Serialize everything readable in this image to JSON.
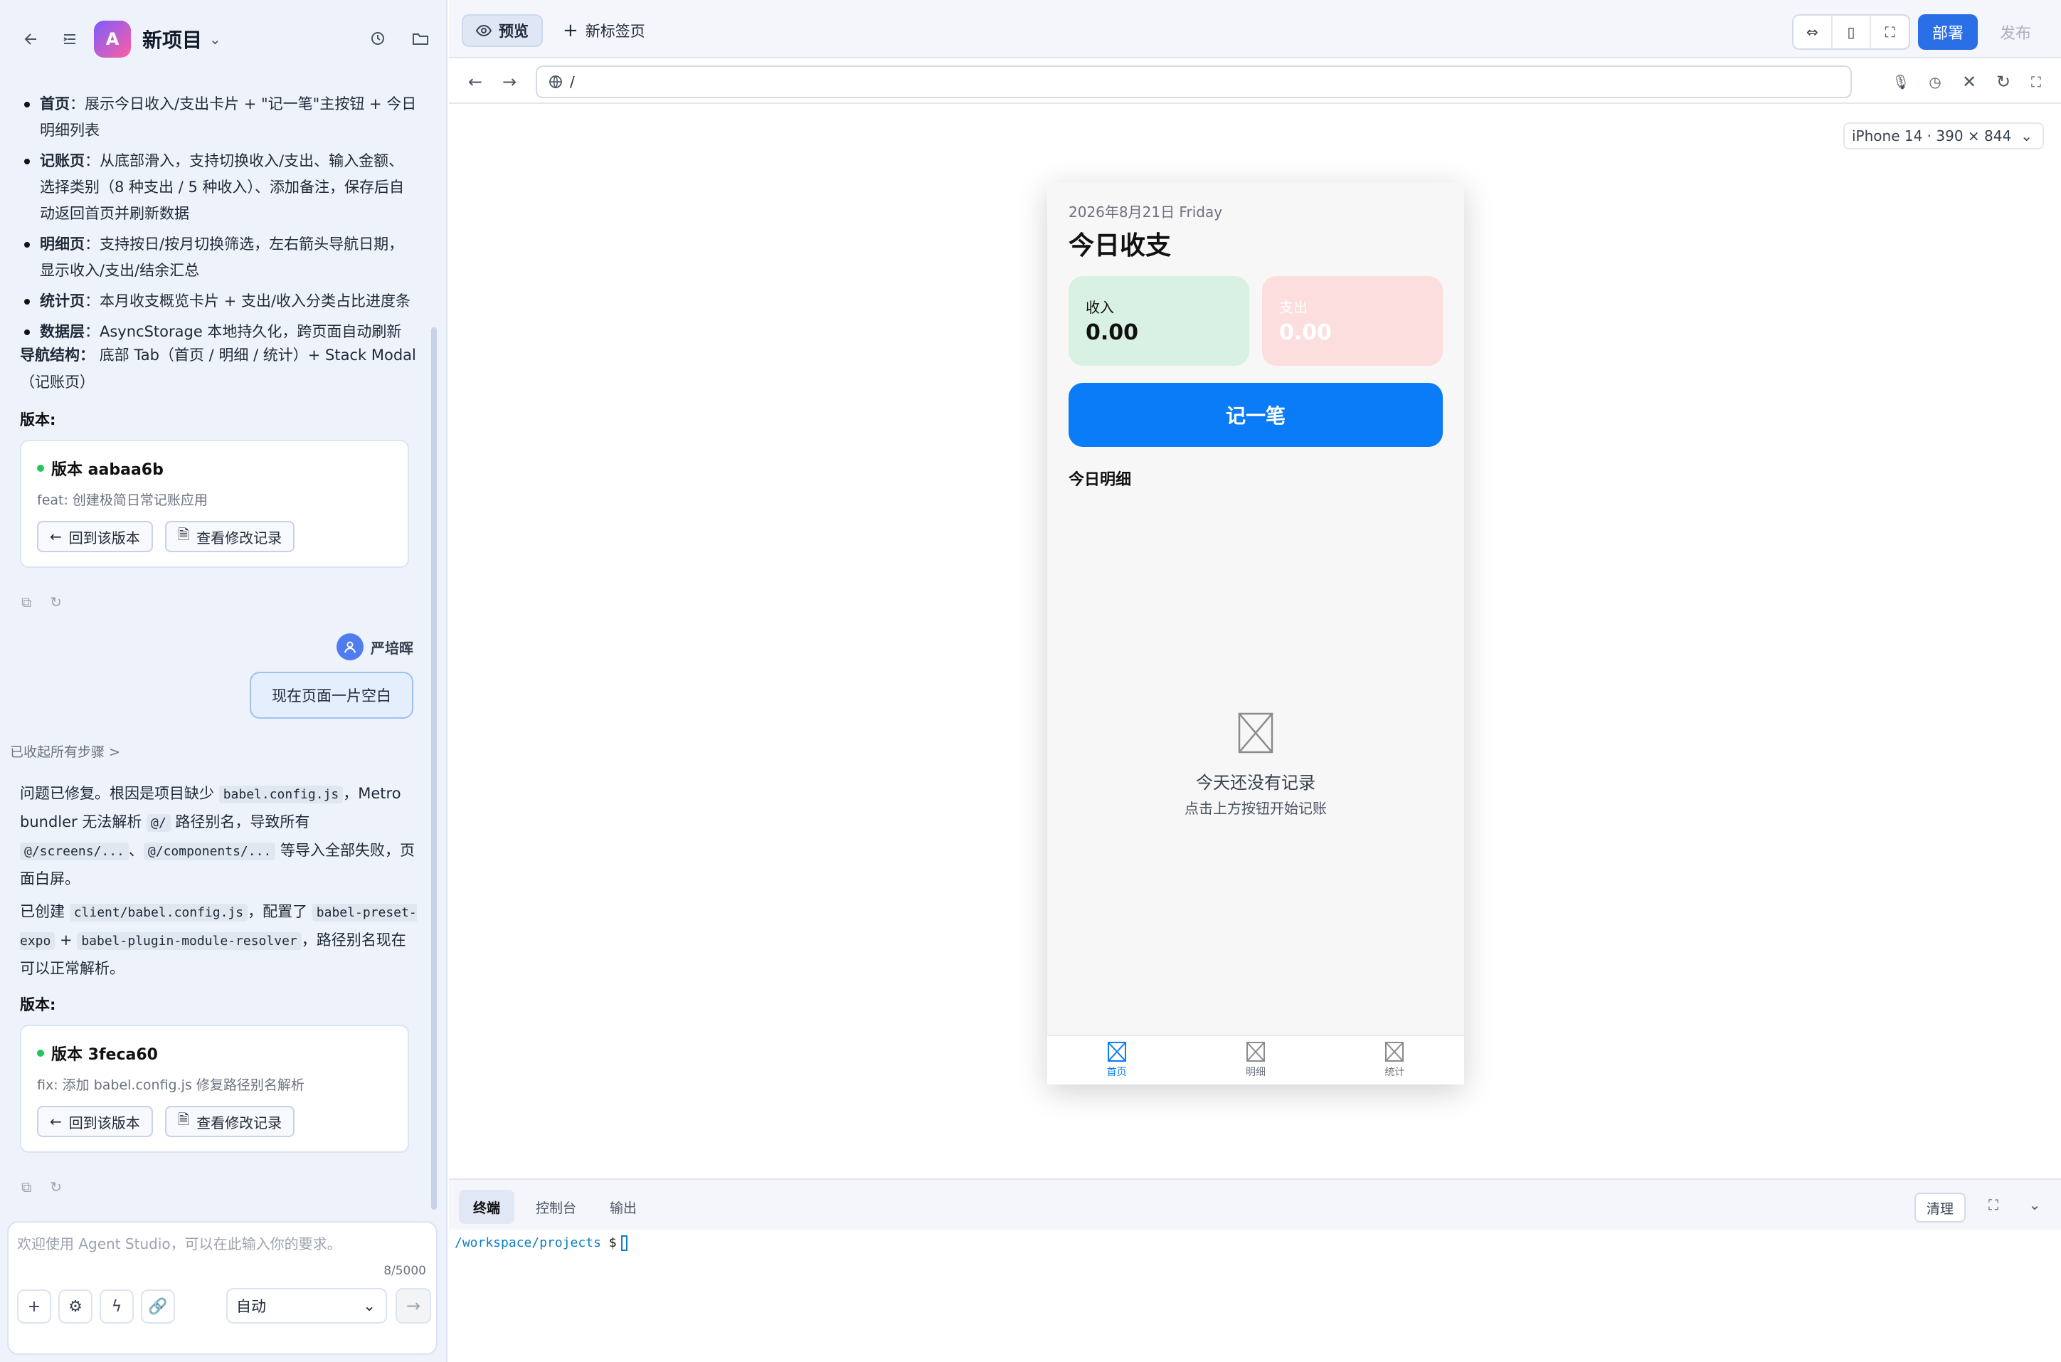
{
  "left_panel": {
    "project_title": "新项目",
    "avatar_letter": "A",
    "bullets": [
      {
        "head": "首页",
        "text": "：展示今日收入/支出卡片 + \"记一笔\"主按钮 + 今日明细列表"
      },
      {
        "head": "记账页",
        "text": "：从底部滑入，支持切换收入/支出、输入金额、选择类别（8 种支出 / 5 种收入）、添加备注，保存后自动返回首页并刷新数据"
      },
      {
        "head": "明细页",
        "text": "：支持按日/按月切换筛选，左右箭头导航日期，显示收入/支出/结余汇总"
      },
      {
        "head": "统计页",
        "text": "：本月收支概览卡片 + 支出/收入分类占比进度条"
      },
      {
        "head": "数据层",
        "text": "：AsyncStorage 本地持久化，跨页面自动刷新"
      }
    ],
    "nav_structure_head": "导航结构：",
    "nav_structure_text": "底部 Tab（首页 / 明细 / 统计）+ Stack Modal（记账页）",
    "version_label": "版本:",
    "versions": [
      {
        "title": "版本 aabaa6b",
        "desc": "feat: 创建极简日常记账应用",
        "revert": "回到该版本",
        "log": "查看修改记录"
      },
      {
        "title": "版本 3feca60",
        "desc": "fix: 添加 babel.config.js 修复路径别名解析",
        "revert": "回到该版本",
        "log": "查看修改记录"
      }
    ],
    "user_name": "严培晖",
    "user_message": "现在页面一片空白",
    "steps_toggle": "已收起所有步骤 >",
    "fix_para1": {
      "t1": "问题已修复。根因是项目缺少 ",
      "c1": "babel.config.js",
      "t2": "，Metro bundler 无法解析 ",
      "c2": "@/",
      "t3": " 路径别名，导致所有 ",
      "c3": "@/screens/...",
      "t4": "、",
      "c4": "@/components/...",
      "t5": " 等导入全部失败，页面白屏。"
    },
    "fix_para2": {
      "t1": "已创建 ",
      "c1": "client/babel.config.js",
      "t2": "，配置了 ",
      "c2": "babel-preset-expo",
      "t3": " + ",
      "c3": "babel-plugin-module-resolver",
      "t4": "，路径别名现在可以正常解析。"
    },
    "chat_placeholder": "欢迎使用 Agent Studio，可以在此输入你的要求。",
    "char_count": "8/5000",
    "mode": "自动"
  },
  "topbar": {
    "tab_preview": "预览",
    "tab_new": "新标签页",
    "deploy": "部署",
    "publish": "发布"
  },
  "address": {
    "url": "/"
  },
  "preview": {
    "device": "iPhone 14 · 390 × 844",
    "app": {
      "date": "2026年8月21日 Friday",
      "title": "今日收支",
      "income_label": "收入",
      "income_value": "0.00",
      "expense_label": "支出",
      "expense_value": "0.00",
      "record_button": "记一笔",
      "detail_title": "今日明细",
      "empty_title": "今天还没有记录",
      "empty_sub": "点击上方按钮开始记账",
      "tabs": [
        "首页",
        "明细",
        "统计"
      ]
    }
  },
  "bottom_panel": {
    "tabs": [
      "终端",
      "控制台",
      "输出"
    ],
    "clear": "清理",
    "prompt_path": "/workspace/projects",
    "prompt_symbol": "$"
  },
  "colors": {
    "accent": "#2a6fe6",
    "app_primary": "#0a7cf7",
    "income_bg": "#d9f1e2",
    "expense_bg": "#fddede",
    "status_green": "#22c55e"
  }
}
